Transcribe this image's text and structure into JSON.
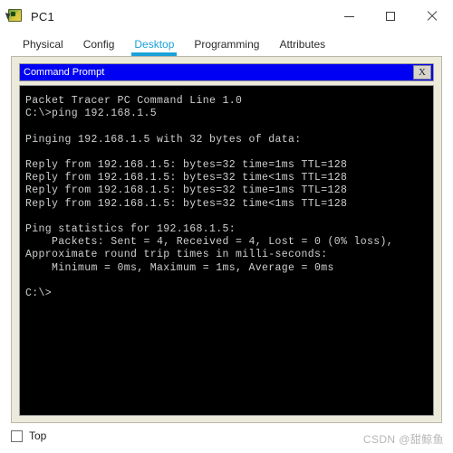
{
  "window": {
    "title": "PC1",
    "icon": "packet-tracer-pc-icon",
    "controls": {
      "minimize_label": "—",
      "maximize_label": "□",
      "close_label": "✕"
    }
  },
  "tabs": [
    {
      "label": "Physical",
      "active": false
    },
    {
      "label": "Config",
      "active": false
    },
    {
      "label": "Desktop",
      "active": true
    },
    {
      "label": "Programming",
      "active": false
    },
    {
      "label": "Attributes",
      "active": false
    }
  ],
  "colors": {
    "accent": "#1ba1d8",
    "panel_beige": "#eceadb",
    "cmd_titlebar_blue": "#0000f2",
    "terminal_bg": "#000000",
    "terminal_fg": "#cfcfcf"
  },
  "command_prompt": {
    "title": "Command Prompt",
    "close_label": "X",
    "lines": [
      "Packet Tracer PC Command Line 1.0",
      "C:\\>ping 192.168.1.5",
      "",
      "Pinging 192.168.1.5 with 32 bytes of data:",
      "",
      "Reply from 192.168.1.5: bytes=32 time=1ms TTL=128",
      "Reply from 192.168.1.5: bytes=32 time<1ms TTL=128",
      "Reply from 192.168.1.5: bytes=32 time=1ms TTL=128",
      "Reply from 192.168.1.5: bytes=32 time<1ms TTL=128",
      "",
      "Ping statistics for 192.168.1.5:",
      "    Packets: Sent = 4, Received = 4, Lost = 0 (0% loss),",
      "Approximate round trip times in milli-seconds:",
      "    Minimum = 0ms, Maximum = 1ms, Average = 0ms",
      "",
      "C:\\>"
    ]
  },
  "bottom": {
    "top_checkbox_label": "Top",
    "top_checkbox_checked": false,
    "watermark": "CSDN @甜鲸鱼"
  }
}
